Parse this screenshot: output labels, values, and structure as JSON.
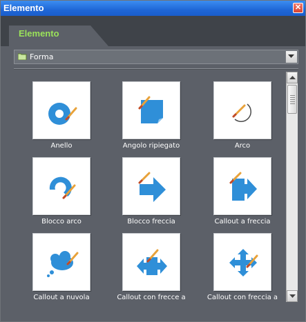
{
  "window": {
    "title": "Elemento",
    "close_glyph": "✕"
  },
  "tab": {
    "label": "Elemento"
  },
  "dropdown": {
    "selected": "Forma",
    "icon": "folder-icon"
  },
  "gallery": {
    "items": [
      {
        "label": "Anello",
        "icon": "ring-shape-icon"
      },
      {
        "label": "Angolo ripiegato",
        "icon": "folded-corner-shape-icon"
      },
      {
        "label": "Arco",
        "icon": "arc-shape-icon"
      },
      {
        "label": "Blocco arco",
        "icon": "block-arc-shape-icon"
      },
      {
        "label": "Blocco freccia",
        "icon": "block-arrow-shape-icon"
      },
      {
        "label": "Callout a freccia",
        "icon": "arrow-callout-shape-icon"
      },
      {
        "label": "Callout a nuvola",
        "icon": "cloud-callout-shape-icon"
      },
      {
        "label": "Callout con frecce a",
        "icon": "left-right-arrow-callout-shape-icon"
      },
      {
        "label": "Callout con freccia a",
        "icon": "quad-arrow-callout-shape-icon"
      }
    ]
  },
  "colors": {
    "shape_blue": "#2f8fd8",
    "tab_text": "#9be25a",
    "titlebar": "#1f67d7"
  }
}
